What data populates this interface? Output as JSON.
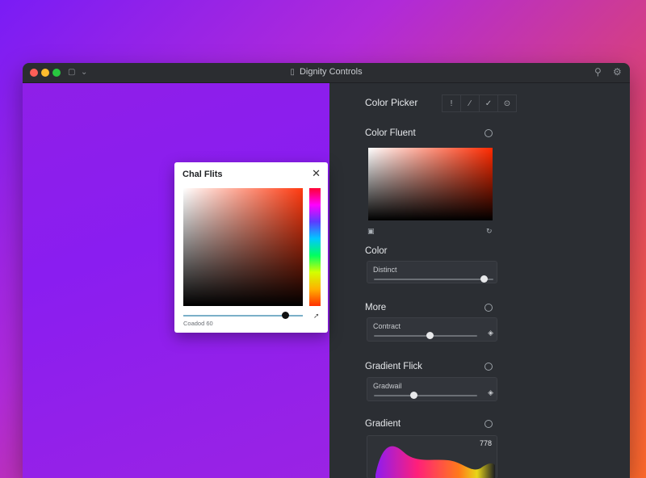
{
  "window": {
    "title": "Dignity Controls"
  },
  "panel": {
    "header": "Color Picker",
    "tools": [
      "!",
      "∕",
      "✓",
      "⊙"
    ],
    "sections": [
      {
        "title": "Color Fluent"
      },
      {
        "title": "Color",
        "card_label": "Distinct",
        "value": 0.92
      },
      {
        "title": "More",
        "card_label": "Contract",
        "value": 0.54
      },
      {
        "title": "Gradient Flick",
        "card_label": "Gradwail",
        "value": 0.38
      },
      {
        "title": "Gradient",
        "readout": "778"
      }
    ]
  },
  "dialog": {
    "title": "Chal Flits",
    "label": "Coadod   60",
    "value": 0.85
  },
  "colors": {
    "panel_bg": "#2b2e33",
    "titlebar_bg": "#2b2d31",
    "accent_red": "#ff2a00"
  },
  "icons": {
    "close": "close-icon",
    "search": "search-icon",
    "gear": "gear-icon",
    "eyedropper": "eyedropper-icon"
  }
}
